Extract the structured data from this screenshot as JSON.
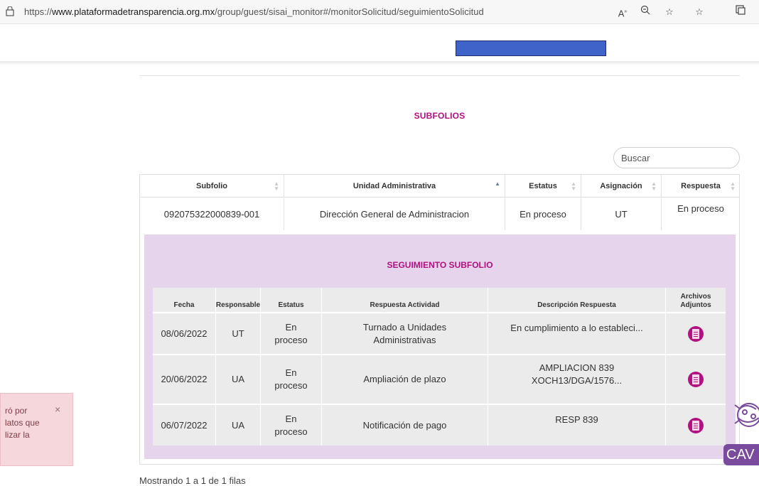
{
  "browser": {
    "url_prefix": "https://",
    "url_domain": "www.plataformadetransparencia.org.mx",
    "url_path": "/group/guest/sisai_monitor#/monitorSolicitud/seguimientoSolicitud"
  },
  "subfolios": {
    "title": "SUBFOLIOS",
    "search_placeholder": "Buscar",
    "headers": [
      "Subfolio",
      "Unidad Administrativa",
      "Estatus",
      "Asignación",
      "Respuesta"
    ],
    "row": {
      "subfolio": "092075322000839-001",
      "unidad": "Dirección General de Administracion",
      "estatus": "En proceso",
      "asignacion": "UT",
      "respuesta": "En proceso"
    },
    "footer": "Mostrando 1 a 1 de 1 filas"
  },
  "seguimiento": {
    "title": "SEGUIMIENTO SUBFOLIO",
    "headers": [
      "Fecha",
      "Responsable",
      "Estatus",
      "Respuesta Actividad",
      "Descripción Respuesta",
      "Archivos Adjuntos"
    ],
    "rows": [
      {
        "fecha": "08/06/2022",
        "responsable": "UT",
        "estatus": "En proceso",
        "actividad": "Turnado a Unidades Administrativas",
        "descripcion": "En cumplimiento a lo estableci..."
      },
      {
        "fecha": "20/06/2022",
        "responsable": "UA",
        "estatus": "En proceso",
        "actividad": "Ampliación de plazo",
        "descripcion": "AMPLIACION 839 XOCH13/DGA/1576..."
      },
      {
        "fecha": "06/07/2022",
        "responsable": "UA",
        "estatus": "En proceso",
        "actividad": "Notificación de pago",
        "descripcion": "RESP 839"
      }
    ]
  },
  "toast": {
    "text": "ró por\nlatos que\nlizar la",
    "close": "×"
  },
  "cav_label": "CAV",
  "colors": {
    "accent": "#b0127f",
    "panel": "#e5d4ec",
    "blue_bar": "#3f63c8"
  }
}
